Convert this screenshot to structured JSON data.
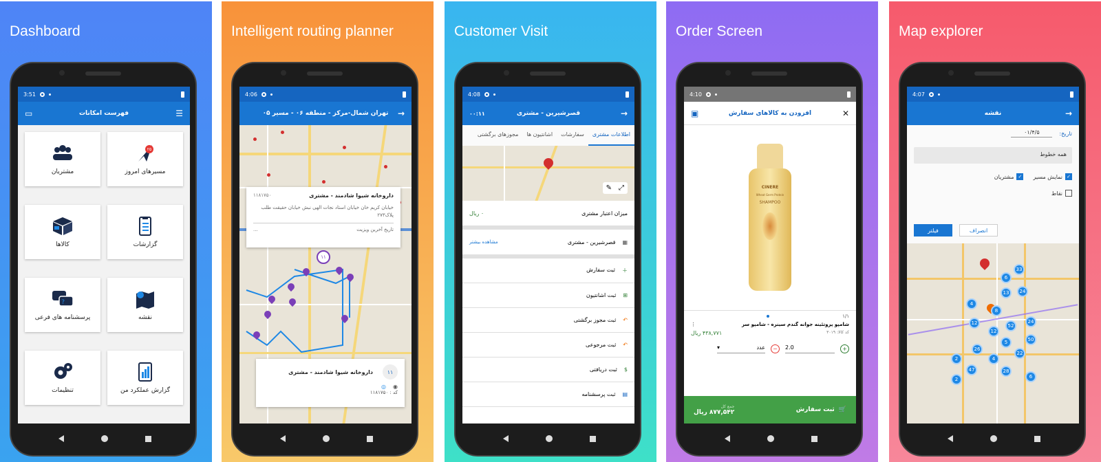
{
  "panels": [
    {
      "title": "Dashboard",
      "time": "3:51",
      "appbar": "فهرست امکانات",
      "tiles": [
        {
          "label": "مسیرهای امروز",
          "badge": "۲۵"
        },
        {
          "label": "مشتریان"
        },
        {
          "label": "گزارشات"
        },
        {
          "label": "کالاها"
        },
        {
          "label": "نقشه"
        },
        {
          "label": "پرسشنامه های فرعی"
        },
        {
          "label": "گزارش عملکرد من"
        },
        {
          "label": "تنظیمات"
        }
      ]
    },
    {
      "title": "Intelligent routing planner",
      "time": "4:06",
      "appbar": "تهران شمال-مرکز - منطقه ۰۶ - مسیر ۰۵",
      "card_top": {
        "name": "داروخانه شیوا شادمند - مشتری",
        "code": "۱۱۸۱۷۵۰",
        "address": "خیابان کریم خان خیابان استاد نجات الهی نبش خیابان حقیقت طلب پلاک۲۷۳",
        "last_visit_label": "تاریخ آخرین ویزیت",
        "last_visit": "..."
      },
      "card_bottom": {
        "name": "داروخانه شیوا شادمند - مشتری",
        "code": "کد : ۱۱۸۱۷۵۰",
        "number": "۱۱"
      },
      "pins": [
        "۱۱",
        "۱۷",
        "۱۸",
        "۱۳",
        "۶",
        "۲",
        "۴",
        "۱۵",
        "۸"
      ]
    },
    {
      "title": "Customer Visit",
      "time": "4:08",
      "appbar": "قصرشیرین - مشتری",
      "timer": "۰۰:۱۱",
      "tabs": [
        "اطلاعات مشتری",
        "سفارشات",
        "اشانتیون ها",
        "مجوزهای برگشتی"
      ],
      "credit_label": "میزان اعتبار مشتری",
      "credit_value": "۰ ریال",
      "customer": "قصرشیرین - مشتری",
      "more": "مشاهده بیشتر",
      "actions": [
        "ثبت سفارش",
        "ثبت اشانتیون",
        "ثبت مجوز برگشتی",
        "ثبت مرجوعی",
        "ثبت دریافتی",
        "ثبت پرسشنامه"
      ]
    },
    {
      "title": "Order Screen",
      "time": "4:10",
      "appbar": "افزودن به کالاهای سفارش",
      "page_indicator": "۱/۱",
      "product_name": "شامپو پروتئینه جوانه گندم سینره - شامپو سر",
      "product_code": "کد کالا: ۳۰۱۹",
      "price": "۴۳۸,۷۷۱ ریال",
      "qty": "2.0",
      "unit": "عدد",
      "total_label": "جمع کل",
      "total": "۸۷۷,۵۴۲ ریال",
      "submit": "ثبت سفارش",
      "bottle_brand": "CINERE",
      "bottle_sub": "Wheat Germ Protein",
      "bottle_label": "SHAMPOO"
    },
    {
      "title": "Map explorer",
      "time": "4:07",
      "appbar": "نقشه",
      "date_label": "تاریخ:",
      "date_value": "۰۱/۴/۵",
      "lines": "همه خطوط",
      "show_route": "نمایش مسیر",
      "customers": "مشتریان",
      "points": "نقاط",
      "filter": "فیلتر",
      "cancel": "انصراف",
      "clusters": [
        "33",
        "6",
        "13",
        "24",
        "4",
        "8",
        "12",
        "12",
        "52",
        "24",
        "5",
        "50",
        "26",
        "22",
        "4",
        "2",
        "47",
        "28",
        "2",
        "6"
      ]
    }
  ]
}
